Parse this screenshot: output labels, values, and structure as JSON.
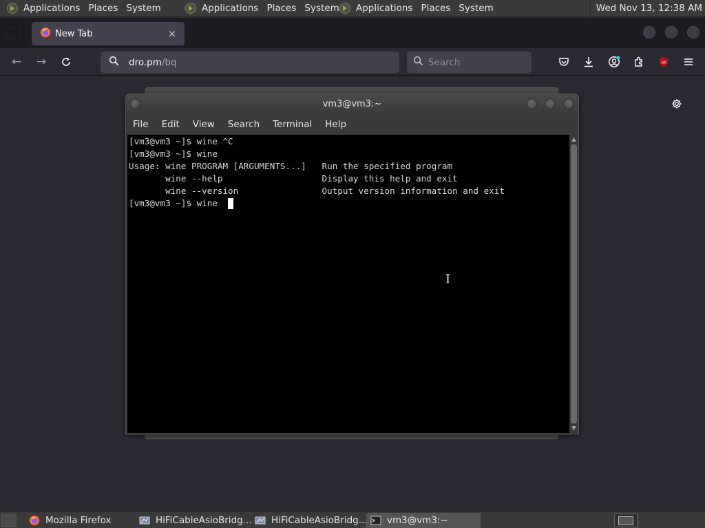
{
  "top_panel": {
    "menus": [
      {
        "applications": "Applications",
        "places": "Places",
        "system": "System"
      },
      {
        "applications": "Applications",
        "places": "Places",
        "system": "System"
      },
      {
        "applications": "Applications",
        "places": "Places",
        "system": "System"
      }
    ],
    "clock": "Wed Nov 13, 12:38 AM"
  },
  "browser": {
    "tab_title": "New Tab",
    "tab_close": "×",
    "url_host": "dro.pm",
    "url_path": "/bq",
    "search_placeholder": "Search"
  },
  "terminal": {
    "title": "vm3@vm3:~",
    "menu": [
      "File",
      "Edit",
      "View",
      "Search",
      "Terminal",
      "Help"
    ],
    "lines": [
      "[vm3@vm3 ~]$ wine ^C",
      "[vm3@vm3 ~]$ wine",
      "Usage: wine PROGRAM [ARGUMENTS...]   Run the specified program",
      "       wine --help                   Display this help and exit",
      "       wine --version                Output version information and exit",
      "[vm3@vm3 ~]$ wine "
    ]
  },
  "taskbar": {
    "tasks": [
      {
        "label": "Mozilla Firefox",
        "icon": "firefox-icon"
      },
      {
        "label": "HiFiCableAsioBridg...",
        "icon": "wine-app-icon"
      },
      {
        "label": "HiFiCableAsioBridg...",
        "icon": "wine-app-icon"
      },
      {
        "label": "vm3@vm3:~",
        "icon": "terminal-icon"
      }
    ]
  },
  "colors": {
    "firefox_bg": "#2b2a33",
    "terminal_bg": "#000000",
    "panel_bg": "#3a3a3a",
    "ublock_red": "#b5121b"
  }
}
